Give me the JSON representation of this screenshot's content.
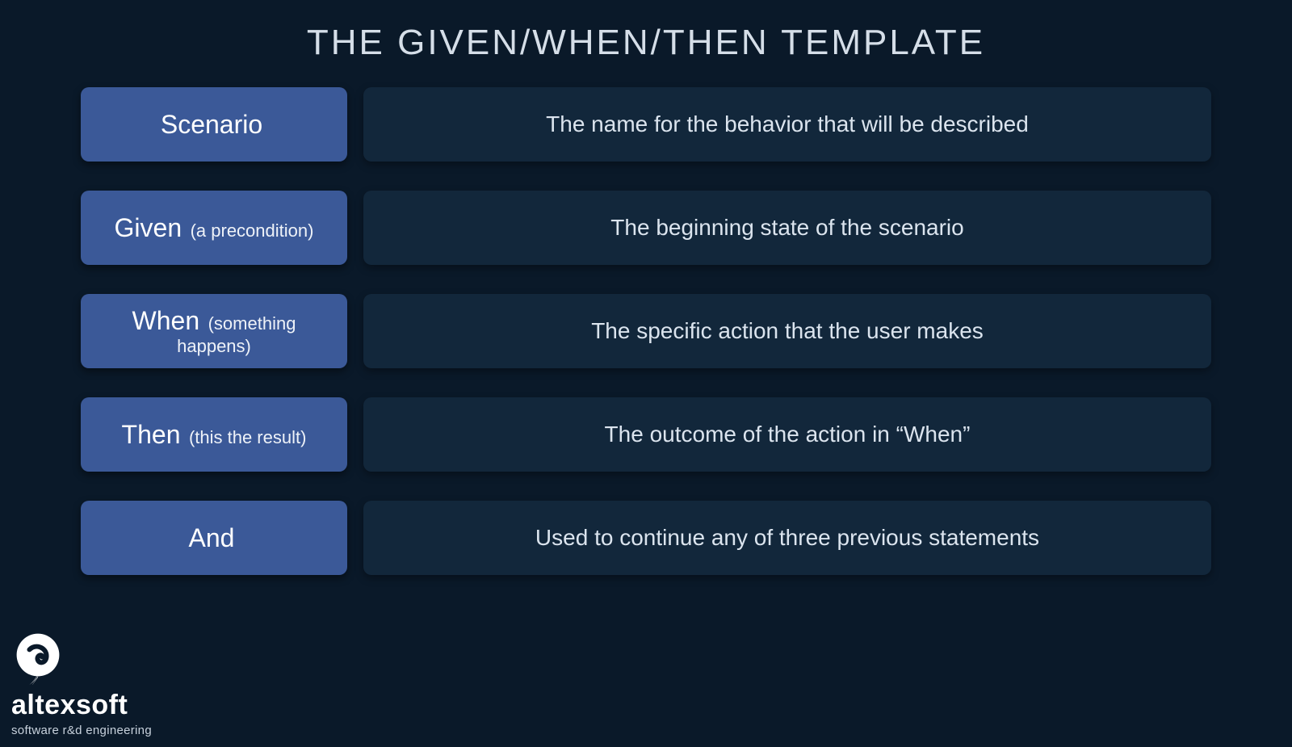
{
  "title": "THE GIVEN/WHEN/THEN TEMPLATE",
  "rows": [
    {
      "label_main": "Scenario",
      "label_sub": "",
      "desc": "The name for the behavior that will be described"
    },
    {
      "label_main": "Given",
      "label_sub": "(a precondition)",
      "desc": "The beginning state of the scenario"
    },
    {
      "label_main": "When",
      "label_sub": "(something happens)",
      "desc": "The specific action that the user makes"
    },
    {
      "label_main": "Then",
      "label_sub": "(this the result)",
      "desc": "The outcome of the action in “When”"
    },
    {
      "label_main": "And",
      "label_sub": "",
      "desc": "Used to continue any of three previous statements"
    }
  ],
  "logo": {
    "name": "altexsoft",
    "tagline": "software r&d engineering"
  }
}
